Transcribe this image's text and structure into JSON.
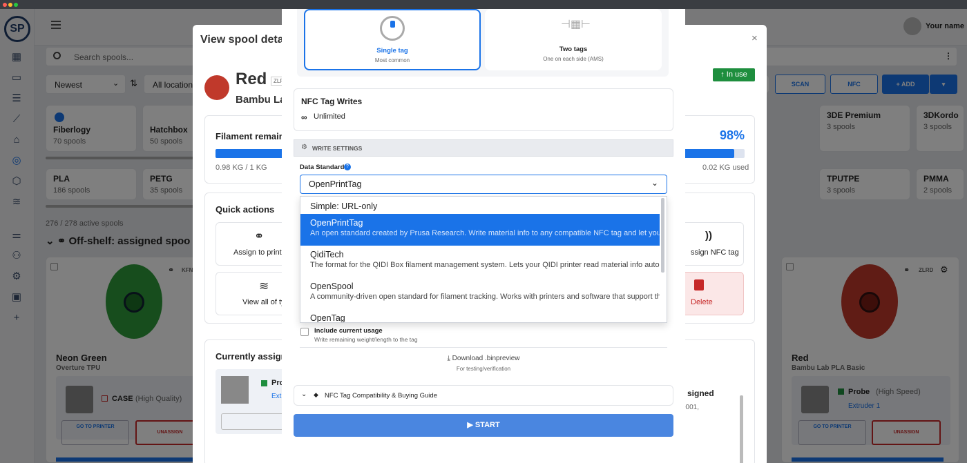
{
  "colors": {
    "accent": "#1a73e8",
    "green": "#1e8e3e",
    "red": "#c62828",
    "spool_green": "#2e9a3a",
    "spool_red": "#c0392b"
  },
  "app": {
    "logo": "SP",
    "user_name": "Your name",
    "search_placeholder": "Search spools..."
  },
  "filters": {
    "sort": "Newest",
    "location": "All location"
  },
  "toolbar": {
    "scan": "SCAN",
    "nfc": "NFC",
    "add": "ADD"
  },
  "brands": [
    {
      "name": "Fiberlogy",
      "count": "70 spools"
    },
    {
      "name": "Hatchbox",
      "count": "50 spools"
    },
    {
      "name": "3DE Premium",
      "count": "3 spools"
    },
    {
      "name": "3DKordo",
      "count": "3 spools"
    }
  ],
  "materials": [
    {
      "name": "PLA",
      "count": "186 spools"
    },
    {
      "name": "PETG",
      "count": "35 spools"
    },
    {
      "name": "TPUTPE",
      "count": "3 spools"
    },
    {
      "name": "PMMA",
      "count": "2 spools"
    }
  ],
  "list": {
    "active_count": "276 / 278 active spools",
    "group_title": "Off-shelf: assigned spoo"
  },
  "spool_left": {
    "code": "KFN",
    "name": "Neon Green",
    "sub": "Overture TPU",
    "printer": "CASE",
    "printer_mode": "(High Quality)",
    "goto": "GO TO PRINTER",
    "unassign": "UNASSIGN"
  },
  "spool_right": {
    "code": "ZLRD",
    "name": "Red",
    "sub": "Bambu Lab PLA Basic",
    "printer": "Probe",
    "printer_mode": "(High Speed)",
    "extruder": "Extruder 1",
    "goto": "GO TO PRINTER",
    "unassign": "UNASSIGN"
  },
  "details": {
    "title": "View spool detail",
    "spool_name": "Red",
    "spool_code": "ZLR",
    "spool_sub": "Bambu La",
    "status": "In use",
    "filament_remaining": "Filament remainin",
    "percent": "98%",
    "remaining_text": "0.98 KG / 1 KG",
    "used_text": "0.02 KG used",
    "progress": 0.98,
    "quick_actions": "Quick actions",
    "assign_printer": "Assign to printe",
    "assign_nfc": "ssign NFC tag",
    "view_all": "View all of ty",
    "delete": "Delete",
    "currently_assigned": "Currently assigne",
    "printer_short": "Pro",
    "extruder_short": "Ext",
    "assigned_text": "signed",
    "assigned_sub": "0001,"
  },
  "nfc": {
    "single_tag": "Single tag",
    "single_tag_sub": "Most common",
    "two_tags": "Two tags",
    "two_tags_sub": "One on each side (AMS)",
    "writes_title": "NFC Tag Writes",
    "writes_value": "Unlimited",
    "write_settings": "WRITE SETTINGS",
    "data_standard_label": "Data Standard",
    "data_standard_value": "OpenPrintTag",
    "options": [
      {
        "title": "Simple: URL-only",
        "desc": ""
      },
      {
        "title": "OpenPrintTag",
        "desc": "An open standard created by Prusa Research. Write material info to any compatible NFC tag and let your Pr"
      },
      {
        "title": "QidiTech",
        "desc": "The format for the QIDI Box filament management system. Lets your QIDI printer read material info automat"
      },
      {
        "title": "OpenSpool",
        "desc": "A community-driven open standard for filament tracking. Works with printers and software that support the"
      },
      {
        "title": "OpenTag",
        "desc": ""
      }
    ],
    "include_usage": "Include current usage",
    "include_usage_sub": "Write remaining weight/length to the tag",
    "download": "Download .binpreview",
    "download_sub": "For testing/verification",
    "guide": "NFC Tag Compatibility & Buying Guide",
    "start": "START"
  }
}
